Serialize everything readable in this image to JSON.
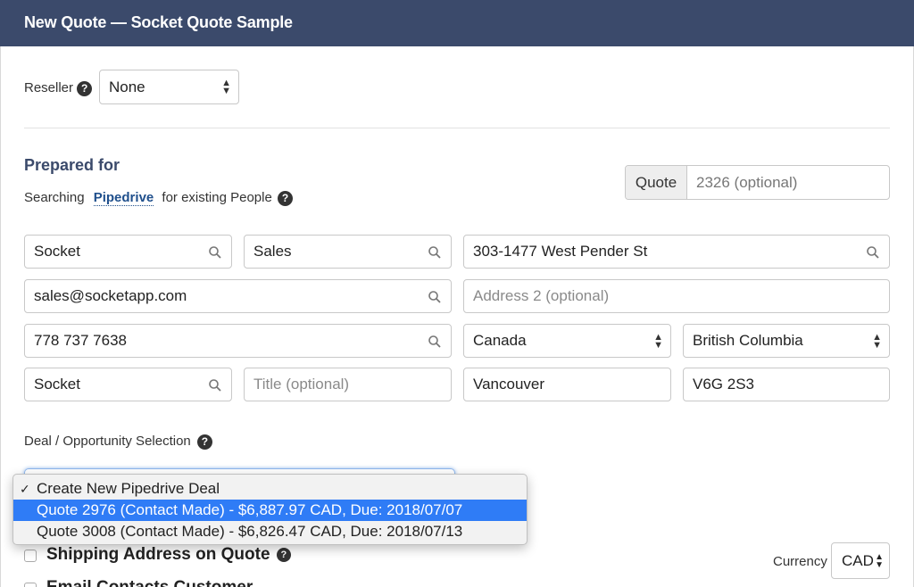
{
  "window": {
    "title": "New Quote — Socket Quote Sample"
  },
  "reseller": {
    "label": "Reseller",
    "value": "None"
  },
  "prepared_for": {
    "title": "Prepared for",
    "search_prefix": "Searching",
    "search_source": "Pipedrive",
    "search_suffix": "for existing People"
  },
  "quote": {
    "addon": "Quote",
    "placeholder": "2326 (optional)"
  },
  "contact": {
    "first_name": "Socket",
    "last_name": "Sales",
    "email": "sales@socketapp.com",
    "phone": "778 737 7638",
    "company": "Socket",
    "title_placeholder": "Title (optional)"
  },
  "address": {
    "line1": "303-1477 West Pender St",
    "line2_placeholder": "Address 2 (optional)",
    "country": "Canada",
    "province": "British Columbia",
    "city": "Vancouver",
    "postal": "V6G 2S3"
  },
  "deal": {
    "label": "Deal / Opportunity Selection",
    "options": [
      "Create New Pipedrive Deal",
      "Quote 2976 (Contact Made) - $6,887.97 CAD, Due: 2018/07/07",
      "Quote 3008 (Contact Made) - $6,826.47 CAD, Due: 2018/07/13"
    ],
    "checked_index": 0,
    "highlighted_index": 1
  },
  "shipping": {
    "label": "Shipping Address on Quote"
  },
  "email_contacts": {
    "label": "Email Contacts Customer"
  },
  "currency": {
    "label": "Currency",
    "value": "CAD"
  },
  "colors": {
    "header": "#3b4a6b",
    "highlight": "#2f7cf6",
    "link": "#1f4f8c"
  },
  "icons": [
    "help-icon",
    "search-icon",
    "select-arrows-icon",
    "checkmark-icon"
  ]
}
